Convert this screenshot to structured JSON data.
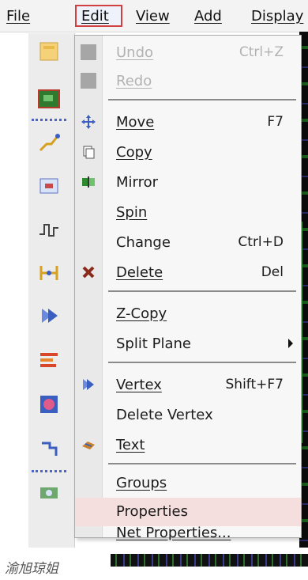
{
  "menubar": {
    "file": "File",
    "edit": "Edit",
    "view": "View",
    "add": "Add",
    "display": "Display"
  },
  "toolbar_icons": [
    "folder-icon",
    "board-icon",
    "route-icon",
    "component-icon",
    "waveform-icon",
    "connect-icon",
    "forward-icon",
    "layers-icon",
    "grid-icon",
    "pin-icon",
    "camera-icon"
  ],
  "edit_menu": {
    "undo": {
      "label": "Undo",
      "shortcut": "Ctrl+Z",
      "disabled": true
    },
    "redo": {
      "label": "Redo",
      "disabled": true
    },
    "move": {
      "label": "Move",
      "shortcut": "F7",
      "icon": "move-cross-icon"
    },
    "copy": {
      "label": "Copy",
      "icon": "copy-icon"
    },
    "mirror": {
      "label": "Mirror",
      "icon": "mirror-icon"
    },
    "spin": {
      "label": "Spin"
    },
    "change": {
      "label": "Change",
      "shortcut": "Ctrl+D"
    },
    "delete": {
      "label": "Delete",
      "shortcut": "Del",
      "icon": "delete-x-icon"
    },
    "zcopy": {
      "label": "Z-Copy"
    },
    "split_plane": {
      "label": "Split Plane",
      "has_submenu": true
    },
    "vertex": {
      "label": "Vertex",
      "shortcut": "Shift+F7",
      "icon": "vertex-icon"
    },
    "delete_vertex": {
      "label": "Delete Vertex"
    },
    "text": {
      "label": "Text",
      "icon": "text-icon"
    },
    "groups": {
      "label": "Groups"
    },
    "properties": {
      "label": "Properties",
      "highlighted": true
    },
    "net_properties": {
      "label": "Net Properties..."
    }
  },
  "caption": "渝旭琼姐",
  "colors": {
    "highlight": "#f5dede",
    "edit_border": "#d04040",
    "disabled_text": "#b2b2b2"
  }
}
